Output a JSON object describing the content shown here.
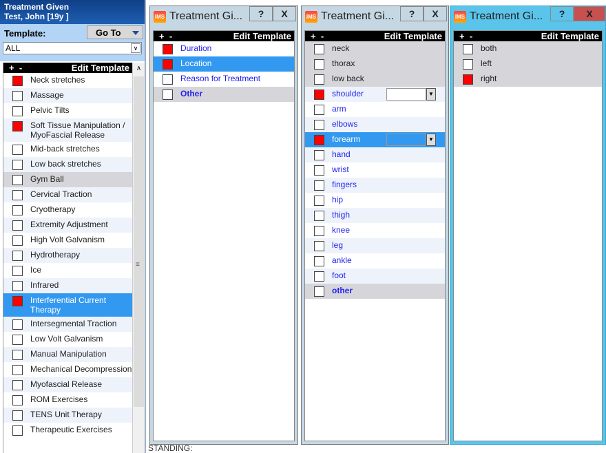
{
  "background": {
    "status_text": "STANDING:"
  },
  "left_panel": {
    "title": "Treatment Given",
    "patient": "Test, John   [19y ]",
    "template_label": "Template:",
    "goto_label": "Go To",
    "template_value": "ALL",
    "header_plus": "+",
    "header_minus": "-",
    "header_label": "Edit Template",
    "items": [
      {
        "label": "Neck stretches",
        "checked": true,
        "bg": "w"
      },
      {
        "label": "Massage",
        "checked": false,
        "bg": "b"
      },
      {
        "label": "Pelvic Tilts",
        "checked": false,
        "bg": "w"
      },
      {
        "label": "Soft Tissue Manipulation / MyoFascial Release",
        "checked": true,
        "bg": "b"
      },
      {
        "label": "Mid-back stretches",
        "checked": false,
        "bg": "w"
      },
      {
        "label": "Low back stretches",
        "checked": false,
        "bg": "b"
      },
      {
        "label": "Gym Ball",
        "checked": false,
        "bg": "g"
      },
      {
        "label": "Cervical Traction",
        "checked": false,
        "bg": "b"
      },
      {
        "label": "Cryotherapy",
        "checked": false,
        "bg": "w"
      },
      {
        "label": "Extremity Adjustment",
        "checked": false,
        "bg": "b"
      },
      {
        "label": "High Volt Galvanism",
        "checked": false,
        "bg": "w"
      },
      {
        "label": "Hydrotherapy",
        "checked": false,
        "bg": "b"
      },
      {
        "label": "Ice",
        "checked": false,
        "bg": "w"
      },
      {
        "label": "Infrared",
        "checked": false,
        "bg": "b"
      },
      {
        "label": "Interferential Current Therapy",
        "checked": true,
        "bg": "s"
      },
      {
        "label": "Intersegmental Traction",
        "checked": false,
        "bg": "b"
      },
      {
        "label": "Low Volt Galvanism",
        "checked": false,
        "bg": "w"
      },
      {
        "label": "Manual Manipulation",
        "checked": false,
        "bg": "b"
      },
      {
        "label": "Mechanical Decompression",
        "checked": false,
        "bg": "w"
      },
      {
        "label": "Myofascial Release",
        "checked": false,
        "bg": "b"
      },
      {
        "label": "ROM Exercises",
        "checked": false,
        "bg": "w"
      },
      {
        "label": "TENS Unit Therapy",
        "checked": false,
        "bg": "b"
      },
      {
        "label": "Therapeutic Exercises",
        "checked": false,
        "bg": "w"
      }
    ]
  },
  "windows": [
    {
      "title": "Treatment Gi...",
      "help": "?",
      "close": "X",
      "header_plus": "+",
      "header_minus": "-",
      "header_label": "Edit Template",
      "blue": true,
      "items": [
        {
          "label": "Duration",
          "checked": true,
          "bg": "w"
        },
        {
          "label": "Location",
          "checked": true,
          "bg": "s"
        },
        {
          "label": "Reason for Treatment",
          "checked": false,
          "bg": "w"
        },
        {
          "label": "Other",
          "checked": false,
          "bg": "g",
          "bold": true
        }
      ]
    },
    {
      "title": "Treatment Gi...",
      "help": "?",
      "close": "X",
      "header_plus": "+",
      "header_minus": "-",
      "header_label": "Edit Template",
      "blue": true,
      "items": [
        {
          "label": "neck",
          "checked": false,
          "bg": "g",
          "plain": true
        },
        {
          "label": "thorax",
          "checked": false,
          "bg": "g",
          "plain": true
        },
        {
          "label": "low back",
          "checked": false,
          "bg": "g",
          "plain": true
        },
        {
          "label": "shoulder",
          "checked": true,
          "bg": "b",
          "dropdown": true
        },
        {
          "label": "arm",
          "checked": false,
          "bg": "w"
        },
        {
          "label": "elbows",
          "checked": false,
          "bg": "b"
        },
        {
          "label": "forearm",
          "checked": true,
          "bg": "s",
          "dropdown": true
        },
        {
          "label": "hand",
          "checked": false,
          "bg": "b"
        },
        {
          "label": "wrist",
          "checked": false,
          "bg": "w"
        },
        {
          "label": "fingers",
          "checked": false,
          "bg": "b"
        },
        {
          "label": "hip",
          "checked": false,
          "bg": "w"
        },
        {
          "label": "thigh",
          "checked": false,
          "bg": "b"
        },
        {
          "label": "knee",
          "checked": false,
          "bg": "w"
        },
        {
          "label": "leg",
          "checked": false,
          "bg": "b"
        },
        {
          "label": "ankle",
          "checked": false,
          "bg": "w"
        },
        {
          "label": "foot",
          "checked": false,
          "bg": "b"
        },
        {
          "label": "other",
          "checked": false,
          "bg": "g",
          "bold": true
        }
      ]
    },
    {
      "title": "Treatment Gi...",
      "help": "?",
      "close": "X",
      "header_plus": "+",
      "header_minus": "-",
      "header_label": "Edit Template",
      "blue": false,
      "active": true,
      "items": [
        {
          "label": "both",
          "checked": false,
          "bg": "g"
        },
        {
          "label": "left",
          "checked": false,
          "bg": "g"
        },
        {
          "label": "right",
          "checked": true,
          "bg": "g"
        }
      ]
    }
  ],
  "colors": {
    "checked": "#ff0000",
    "selected_row": "#3399f0",
    "active_window_border": "#5bc4ea",
    "close_active": "#c75050"
  }
}
